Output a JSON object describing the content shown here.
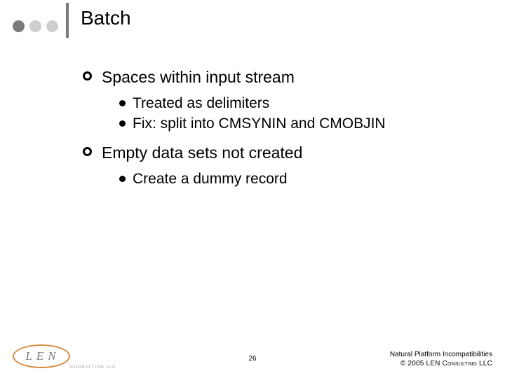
{
  "title": "Batch",
  "bullets": {
    "b1": {
      "text": "Spaces within input stream",
      "sub": {
        "s1": "Treated as delimiters",
        "s2": "Fix: split into CMSYNIN and CMOBJIN"
      }
    },
    "b2": {
      "text": "Empty data sets not created",
      "sub": {
        "s1": "Create a dummy record"
      }
    }
  },
  "page_number": "26",
  "footer": {
    "line1": "Natural Platform Incompatibilities",
    "line2": "© 2005 LEN Consulting LLC"
  },
  "logo": {
    "letters": "LEN",
    "sub": "CONSULTING LLC"
  }
}
